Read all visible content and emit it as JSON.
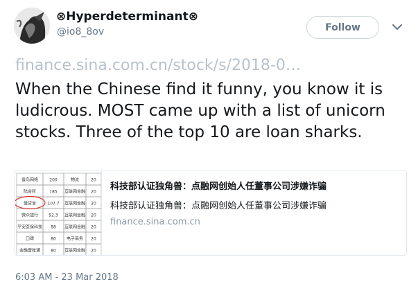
{
  "user": {
    "display_name": "⊗Hyperdeterminant⊗",
    "handle": "@io8_8ov"
  },
  "follow_label": "Follow",
  "tweet": {
    "link_text": "finance.sina.com.cn/stock/s/2018-0…",
    "text": "When the Chinese find it funny, you know it is ludicrous. MOST came up with a list of unicorn stocks. Three of the top 10 are loan sharks.",
    "timestamp": "6:03 AM - 23 Mar 2018"
  },
  "card": {
    "title": "科技部认证独角兽：点融网创始人任董事公司涉嫌诈骗",
    "description": "科技部认证独角兽：点融网创始人任董事公司涉嫌诈骗",
    "domain": "finance.sina.com.cn",
    "table_rows": [
      [
        "蛋鸟网络",
        "200",
        "物流",
        "20"
      ],
      [
        "陆金所",
        "185",
        "互联网金融",
        "20"
      ],
      [
        "借贷宝",
        "107.7",
        "互联网金融",
        "20"
      ],
      [
        "微众银行",
        "92.3",
        "互联网金融",
        "20"
      ],
      [
        "平安医保科技",
        "88",
        "互联网金融",
        "20"
      ],
      [
        "口碑",
        "80",
        "电子商务",
        "20"
      ],
      [
        "金融壹账通",
        "80",
        "互联网金融",
        "20"
      ]
    ]
  },
  "colors": {
    "follow_border": "#cbd4da",
    "link_gray": "#b8c2cb",
    "secondary_text": "#657786",
    "highlight_circle": "#d8342b"
  }
}
